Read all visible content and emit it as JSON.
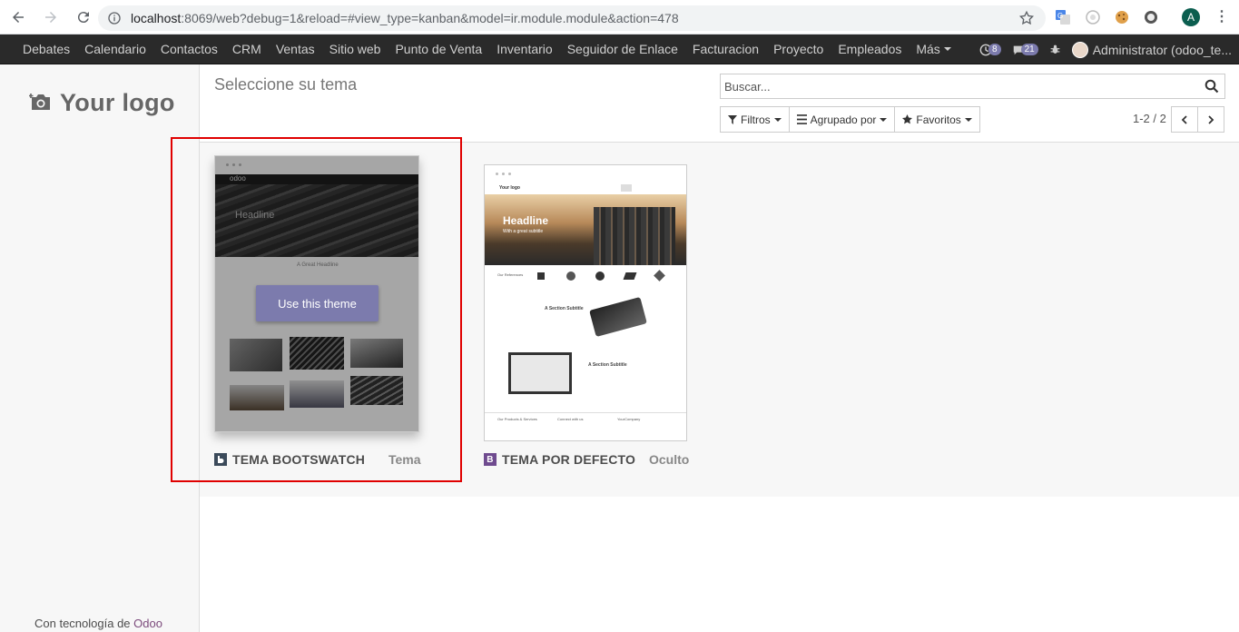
{
  "browser": {
    "url_host": "localhost",
    "url_rest": ":8069/web?debug=1&reload=#view_type=kanban&model=ir.module.module&action=478",
    "profile_initial": "A"
  },
  "navbar": {
    "menu": [
      "Debates",
      "Calendario",
      "Contactos",
      "CRM",
      "Ventas",
      "Sitio web",
      "Punto de Venta",
      "Inventario",
      "Seguidor de Enlace",
      "Facturacion",
      "Proyecto",
      "Empleados",
      "Más"
    ],
    "activity_count": "8",
    "message_count": "21",
    "user": "Administrator (odoo_te..."
  },
  "sidebar": {
    "logo_text": "Your logo",
    "powered_prefix": "Con tecnología de",
    "powered_brand": "Odoo"
  },
  "control_panel": {
    "title": "Seleccione su tema",
    "search_placeholder": "Buscar...",
    "filters_label": "Filtros",
    "group_by_label": "Agrupado por",
    "favorites_label": "Favoritos",
    "pager": "1-2 / 2"
  },
  "themes": [
    {
      "name": "TEMA BOOTSWATCH",
      "state": "Tema",
      "use_button": "Use this theme",
      "preview": {
        "brand": "odoo",
        "headline": "Headline",
        "subtitle": "A Great Headline"
      }
    },
    {
      "name": "TEMA POR DEFECTO",
      "state": "Oculto",
      "icon_letter": "B",
      "preview": {
        "brand": "Your logo",
        "headline": "Headline",
        "subheadline": "With a great subtitle",
        "references": "Our References",
        "section1": "A Section Subtitle",
        "section2": "A Section Subtitle",
        "footer_col1": "Our Products & Services",
        "footer_col2": "Connect with us",
        "footer_col3": "YourCompany"
      }
    }
  ],
  "colors": {
    "accent": "#7c7bad",
    "navbar": "#2a2a2a",
    "highlight": "#e00000"
  }
}
